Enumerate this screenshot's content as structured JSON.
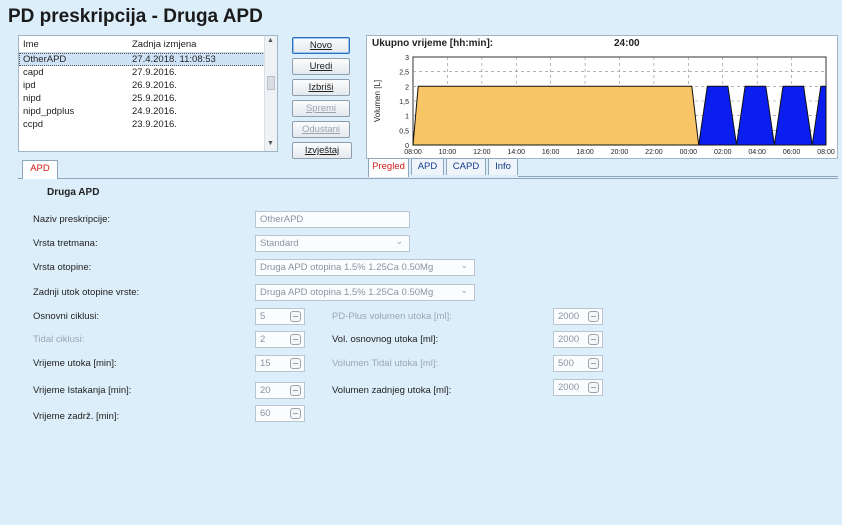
{
  "title": "PD preskripcija - Druga APD",
  "list": {
    "headers": [
      "Ime",
      "Zadnja izmjena"
    ],
    "rows": [
      {
        "name": "OtherAPD",
        "date": "27.4.2018. 11:08:53"
      },
      {
        "name": "capd",
        "date": "27.9.2016."
      },
      {
        "name": "ipd",
        "date": "26.9.2016."
      },
      {
        "name": "nipd",
        "date": "25.9.2016."
      },
      {
        "name": "nipd_pdplus",
        "date": "24.9.2016."
      },
      {
        "name": "ccpd",
        "date": "23.9.2016."
      }
    ]
  },
  "buttons": {
    "novo": "Novo",
    "uredi": "Uredi",
    "izbrisi": "Izbriši",
    "spremi": "Spremi",
    "odustani": "Odustani",
    "izvjestaj": "Izvještaj"
  },
  "chart_data": {
    "type": "area",
    "title": "Ukupno vrijeme [hh:min]:",
    "total": "24:00",
    "ylabel": "Volumen [L]",
    "yticks": [
      "0",
      "0,5",
      "1",
      "1,5",
      "2",
      "2,5",
      "3"
    ],
    "ylim": [
      0,
      3
    ],
    "xticks": [
      "08:00",
      "10:00",
      "12:00",
      "14:00",
      "16:00",
      "18:00",
      "20:00",
      "22:00",
      "00:00",
      "02:00",
      "04:00",
      "06:00",
      "08:00"
    ],
    "xlim_hours": [
      0,
      24
    ],
    "series": [
      {
        "color": "#f7c566",
        "points": [
          [
            0,
            0
          ],
          [
            0.3,
            2
          ],
          [
            16.2,
            2
          ],
          [
            16.6,
            0
          ]
        ]
      },
      {
        "color": "#0a1ef0",
        "points": [
          [
            16.6,
            0
          ],
          [
            17.1,
            2
          ],
          [
            18.3,
            2
          ],
          [
            18.8,
            0
          ],
          [
            19.3,
            2
          ],
          [
            20.5,
            2
          ],
          [
            21.0,
            0
          ],
          [
            21.5,
            2
          ],
          [
            22.7,
            2
          ],
          [
            23.2,
            0
          ],
          [
            23.7,
            2
          ],
          [
            24.0,
            2
          ],
          [
            24.0,
            0
          ]
        ]
      }
    ],
    "colors": {
      "apd_fill": "#f7c566",
      "night_fill": "#0a1ef0"
    }
  },
  "chart_tabs": [
    "Pregled",
    "APD",
    "CAPD",
    "Info"
  ],
  "apd_tab": "APD",
  "form": {
    "section": "Druga APD",
    "naziv_label": "Naziv preskripcije:",
    "naziv_value": "OtherAPD",
    "vrsta_tretmana_label": "Vrsta tretmana:",
    "vrsta_tretmana_value": "Standard",
    "vrsta_otopine_label": "Vrsta otopine:",
    "vrsta_otopine_value": "Druga APD otopina 1.5% 1.25Ca 0.50Mg",
    "zadnji_utok_label": "Zadnji utok otopine vrste:",
    "zadnji_utok_value": "Druga APD otopina 1.5% 1.25Ca 0.50Mg",
    "osnovni_ciklusi_label": "Osnovni ciklusi:",
    "osnovni_ciklusi_value": "5",
    "tidal_ciklusi_label": "Tidal ciklusi:",
    "tidal_ciklusi_value": "2",
    "vrijeme_utoka_label": "Vrijeme utoka [min]:",
    "vrijeme_utoka_value": "15",
    "vrijeme_istakanja_label": "Vrijeme Istakanja [min]:",
    "vrijeme_istakanja_value": "20",
    "vrijeme_zadrz_label": "Vrijeme zadrž. [min]:",
    "vrijeme_zadrz_value": "60",
    "pdplus_label": "PD-Plus volumen utoka [ml]:",
    "pdplus_value": "2000",
    "vol_osnovnog_label": "Vol. osnovnog utoka [ml]:",
    "vol_osnovnog_value": "2000",
    "vol_tidal_label": "Volumen Tidal utoka [ml]:",
    "vol_tidal_value": "500",
    "vol_zadnjeg_label": "Volumen zadnjeg utoka [ml]:",
    "vol_zadnjeg_value": "2000"
  }
}
